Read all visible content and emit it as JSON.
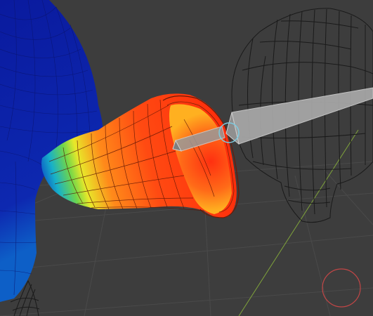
{
  "viewport": {
    "background": "#3d3d3d",
    "grid_color": "#4a4a4a",
    "y_axis_color": "#7fa33b",
    "wireframe_color": "#1a1a1a",
    "weight_gradient": [
      "#0a1a9e",
      "#0d5fc7",
      "#17b0c9",
      "#6fd64a",
      "#e8e82a",
      "#ff8a1a",
      "#ff2a0a"
    ],
    "cursor_color": "#c24646",
    "gizmo_color": "#7ecbe0"
  },
  "objects": [
    {
      "name": "arm-mesh",
      "display": "weight-paint",
      "selected": true
    },
    {
      "name": "torso-mesh",
      "display": "weight-paint"
    },
    {
      "name": "head-mesh",
      "display": "wireframe"
    },
    {
      "name": "bone",
      "display": "octahedral",
      "selected": true
    }
  ],
  "cursor": {
    "icon": "3d-cursor-icon"
  }
}
